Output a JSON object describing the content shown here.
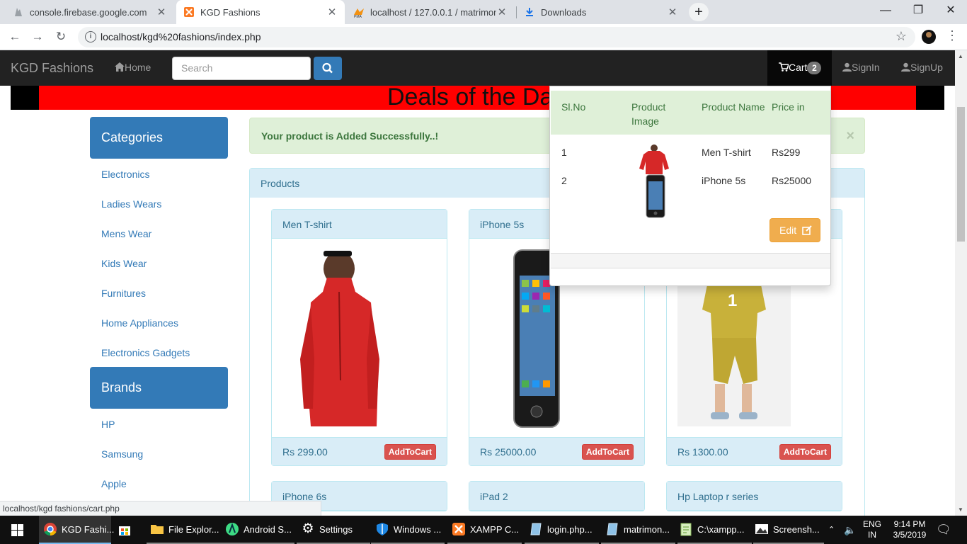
{
  "browser": {
    "tabs": [
      {
        "title": "console.firebase.google.com",
        "active": false
      },
      {
        "title": "KGD Fashions",
        "active": true
      },
      {
        "title": "localhost / 127.0.0.1 / matrimony",
        "active": false
      },
      {
        "title": "Downloads",
        "active": false
      }
    ],
    "url": "localhost/kgd%20fashions/index.php",
    "status_url": "localhost/kgd fashions/cart.php"
  },
  "navbar": {
    "brand": "KGD Fashions",
    "home": "Home",
    "search_placeholder": "Search",
    "cart_label": "Cart",
    "cart_count": "2",
    "signin": "SignIn",
    "signup": "SignUp"
  },
  "banner": {
    "text": "Deals of the Day"
  },
  "sidebar": {
    "categories_title": "Categories",
    "categories": [
      "Electronics",
      "Ladies Wears",
      "Mens Wear",
      "Kids Wear",
      "Furnitures",
      "Home Appliances",
      "Electronics Gadgets"
    ],
    "brands_title": "Brands",
    "brands": [
      "HP",
      "Samsung",
      "Apple"
    ]
  },
  "alert": {
    "message": "Your product is Added Successfully..!",
    "close": "×"
  },
  "products": {
    "panel_title": "Products",
    "add_label": "AddToCart",
    "items": [
      {
        "name": "Men T-shirt",
        "price": "Rs 299.00"
      },
      {
        "name": "iPhone 5s",
        "price": "Rs 25000.00"
      },
      {
        "name": "",
        "price": "Rs 1300.00"
      },
      {
        "name": "iPhone 6s",
        "price": ""
      },
      {
        "name": "iPad 2",
        "price": ""
      },
      {
        "name": "Hp Laptop r series",
        "price": ""
      }
    ]
  },
  "cart_dropdown": {
    "headers": {
      "slno": "Sl.No",
      "image": "Product Image",
      "name": "Product Name",
      "price": "Price in"
    },
    "rows": [
      {
        "slno": "1",
        "name": "Men T-shirt",
        "price": "Rs299"
      },
      {
        "slno": "2",
        "name": "iPhone 5s",
        "price": "Rs25000"
      }
    ],
    "edit_label": "Edit"
  },
  "taskbar": {
    "items": [
      {
        "label": "KGD Fashi...",
        "icon": "chrome-icon"
      },
      {
        "label": "",
        "icon": "store-icon"
      },
      {
        "label": "File Explor...",
        "icon": "folder-icon"
      },
      {
        "label": "Android S...",
        "icon": "android-studio-icon"
      },
      {
        "label": "Settings",
        "icon": "gear-icon"
      },
      {
        "label": "Windows ...",
        "icon": "shield-icon"
      },
      {
        "label": "XAMPP C...",
        "icon": "xampp-icon"
      },
      {
        "label": "login.php...",
        "icon": "notepad-icon"
      },
      {
        "label": "matrimon...",
        "icon": "notepad-icon"
      },
      {
        "label": "C:\\xampp...",
        "icon": "notepad-plus-icon"
      },
      {
        "label": "Screensh...",
        "icon": "photos-icon"
      }
    ],
    "lang_1": "ENG",
    "lang_2": "IN",
    "time": "9:14 PM",
    "date": "3/5/2019"
  }
}
